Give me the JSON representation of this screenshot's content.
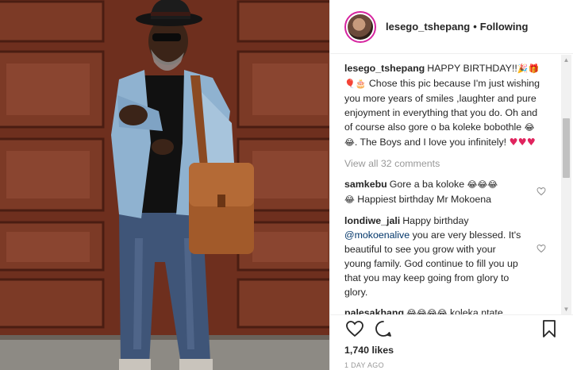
{
  "post": {
    "username": "lesego_tshepang",
    "follow_sep": "•",
    "follow_status": "Following"
  },
  "caption": {
    "username": "lesego_tshepang",
    "text_part1": "HAPPY BIRTHDAY!!",
    "emoji1": "🎉🎁",
    "emoji2": "🎈🎂",
    "text_part2": " Chose this pic because I'm just wishing you more years of smiles ,laughter and pure enjoyment in everything that you do. Oh and of course also gore o ba koleke bobothle ",
    "emoji3": "😂😂",
    "text_part3": ". The Boys and I love you infinitely! ",
    "emoji4": "♥♥♥"
  },
  "view_all_comments": "View all 32 comments",
  "comments": [
    {
      "username": "samkebu",
      "text": "Gore a ba koloke ",
      "emoji": "😂😂😂",
      "text2": " Happiest birthday Mr Mokoena",
      "emoji_lead": "😂"
    },
    {
      "username": "londiwe_jali",
      "text": "Happy birthday",
      "mention": "@mokoenalive",
      "text2": " you are very blessed. It's beautiful to see you grow with your young family. God continue to fill you up that you may keep going from glory to glory."
    },
    {
      "username": "palesakhang",
      "emoji": "😂😂😂😂",
      "text": " koleka ntate mokoena"
    }
  ],
  "likes": "1,740 likes",
  "time": "1 DAY AGO",
  "icons": {
    "like": "heart-icon",
    "comment": "comment-icon",
    "save": "bookmark-icon",
    "comment_like": "heart-outline-icon"
  },
  "colors": {
    "story_ring": "#d6249f",
    "link": "#003569",
    "meta": "#999999",
    "heart_red": "#e0245e"
  }
}
